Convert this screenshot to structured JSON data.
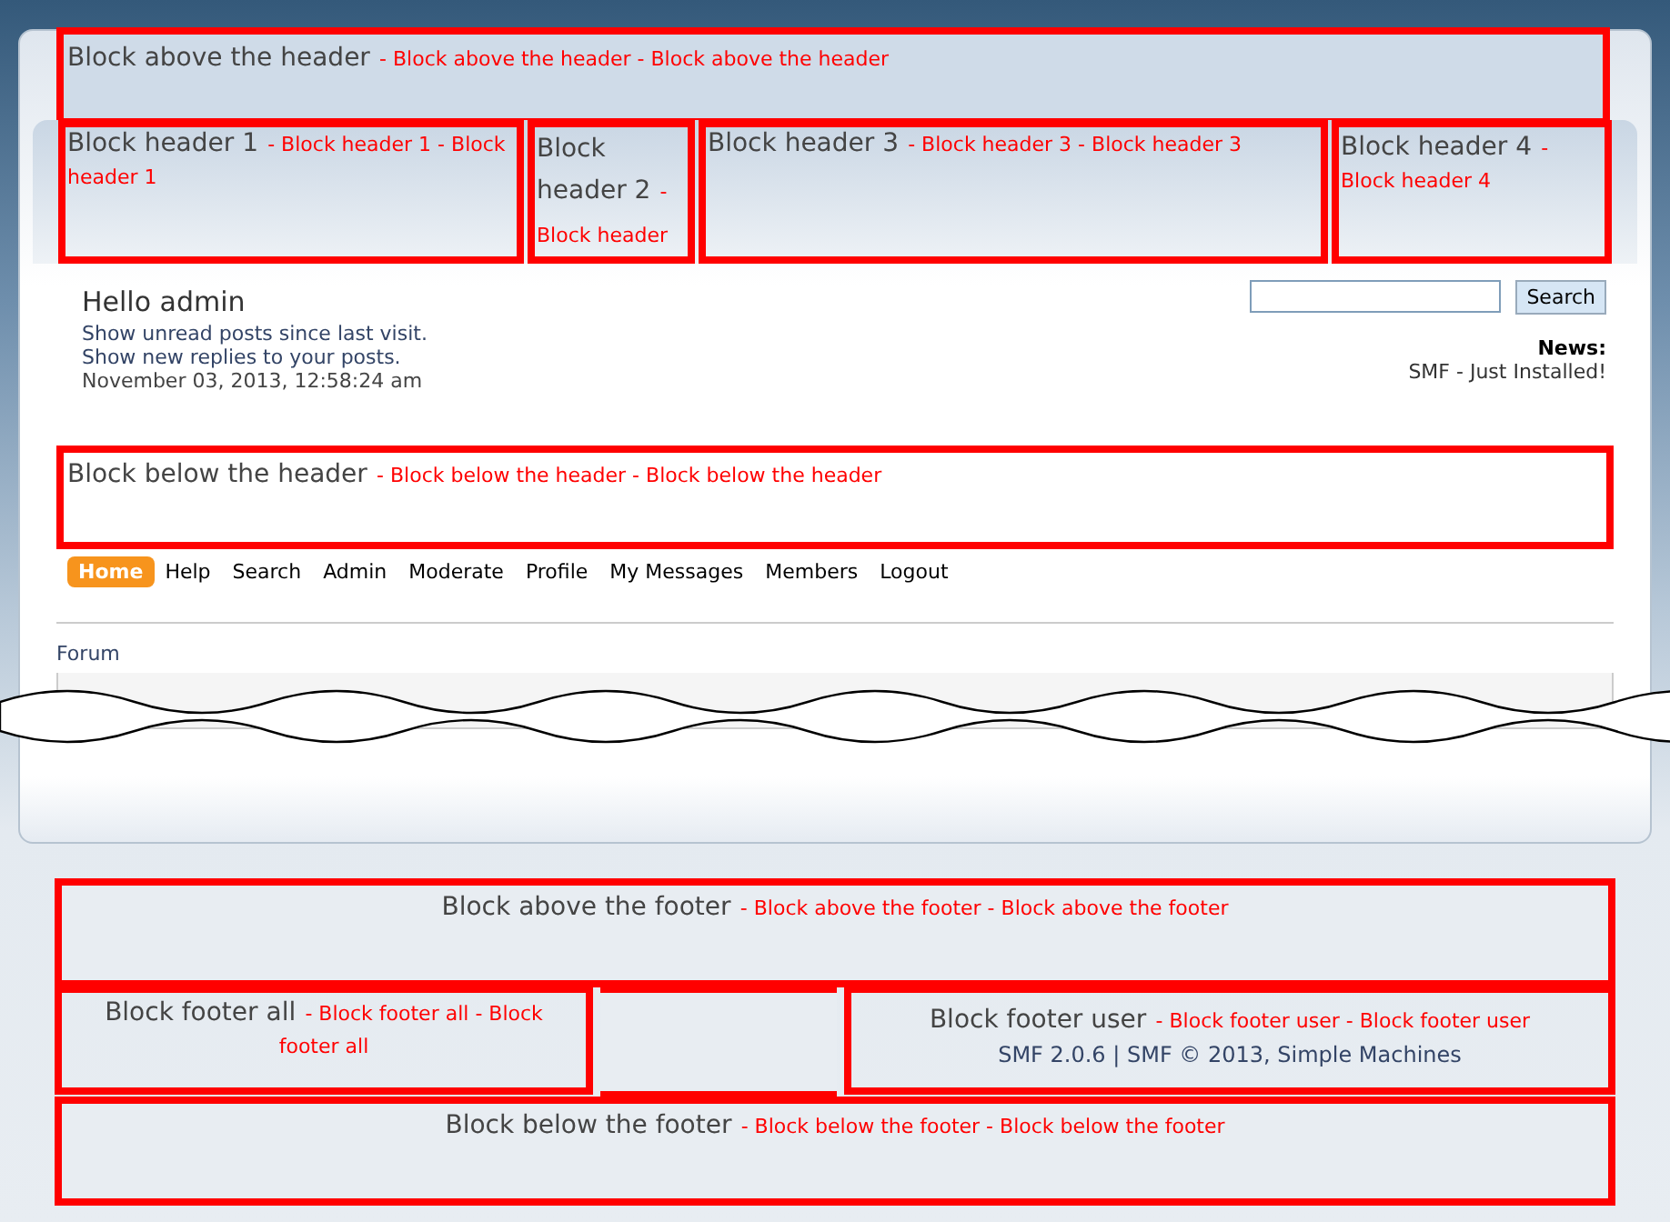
{
  "block_above_header": {
    "title": "Block above the header",
    "text": "- Block above the header - Block above the header"
  },
  "header_blocks": [
    {
      "title": "Block header 1",
      "text": "- Block header 1 - Block header 1"
    },
    {
      "title": "Block header 2",
      "text": "- Block header"
    },
    {
      "title": "Block header 3",
      "text": "- Block header 3 - Block header 3"
    },
    {
      "title": "Block header 4",
      "text": "- Block header 4"
    }
  ],
  "user": {
    "greeting": "Hello admin",
    "links": [
      "Show unread posts since last visit.",
      "Show new replies to your posts."
    ],
    "date": "November 03, 2013, 12:58:24 am"
  },
  "search": {
    "button": "Search"
  },
  "news": {
    "label": "News:",
    "text": "SMF - Just Installed!"
  },
  "block_below_header": {
    "title": "Block below the header",
    "text": "- Block below the header - Block below the header"
  },
  "menu": [
    {
      "label": "Home",
      "selected": true
    },
    {
      "label": "Help",
      "selected": false
    },
    {
      "label": "Search",
      "selected": false
    },
    {
      "label": "Admin",
      "selected": false
    },
    {
      "label": "Moderate",
      "selected": false
    },
    {
      "label": "Profile",
      "selected": false
    },
    {
      "label": "My Messages",
      "selected": false
    },
    {
      "label": "Members",
      "selected": false
    },
    {
      "label": "Logout",
      "selected": false
    }
  ],
  "breadcrumb": "Forum",
  "block_above_footer": {
    "title": "Block above the footer",
    "text": "- Block above the footer - Block above the footer"
  },
  "block_footer_all": {
    "title": "Block footer all",
    "text": "- Block footer all - Block footer all"
  },
  "block_footer_user": {
    "title": "Block footer user",
    "text": "- Block footer user - Block footer user",
    "copyright": "SMF 2.0.6 | SMF © 2013, Simple Machines"
  },
  "block_below_footer": {
    "title": "Block below the footer",
    "text": "- Block below the footer - Block below the footer"
  }
}
